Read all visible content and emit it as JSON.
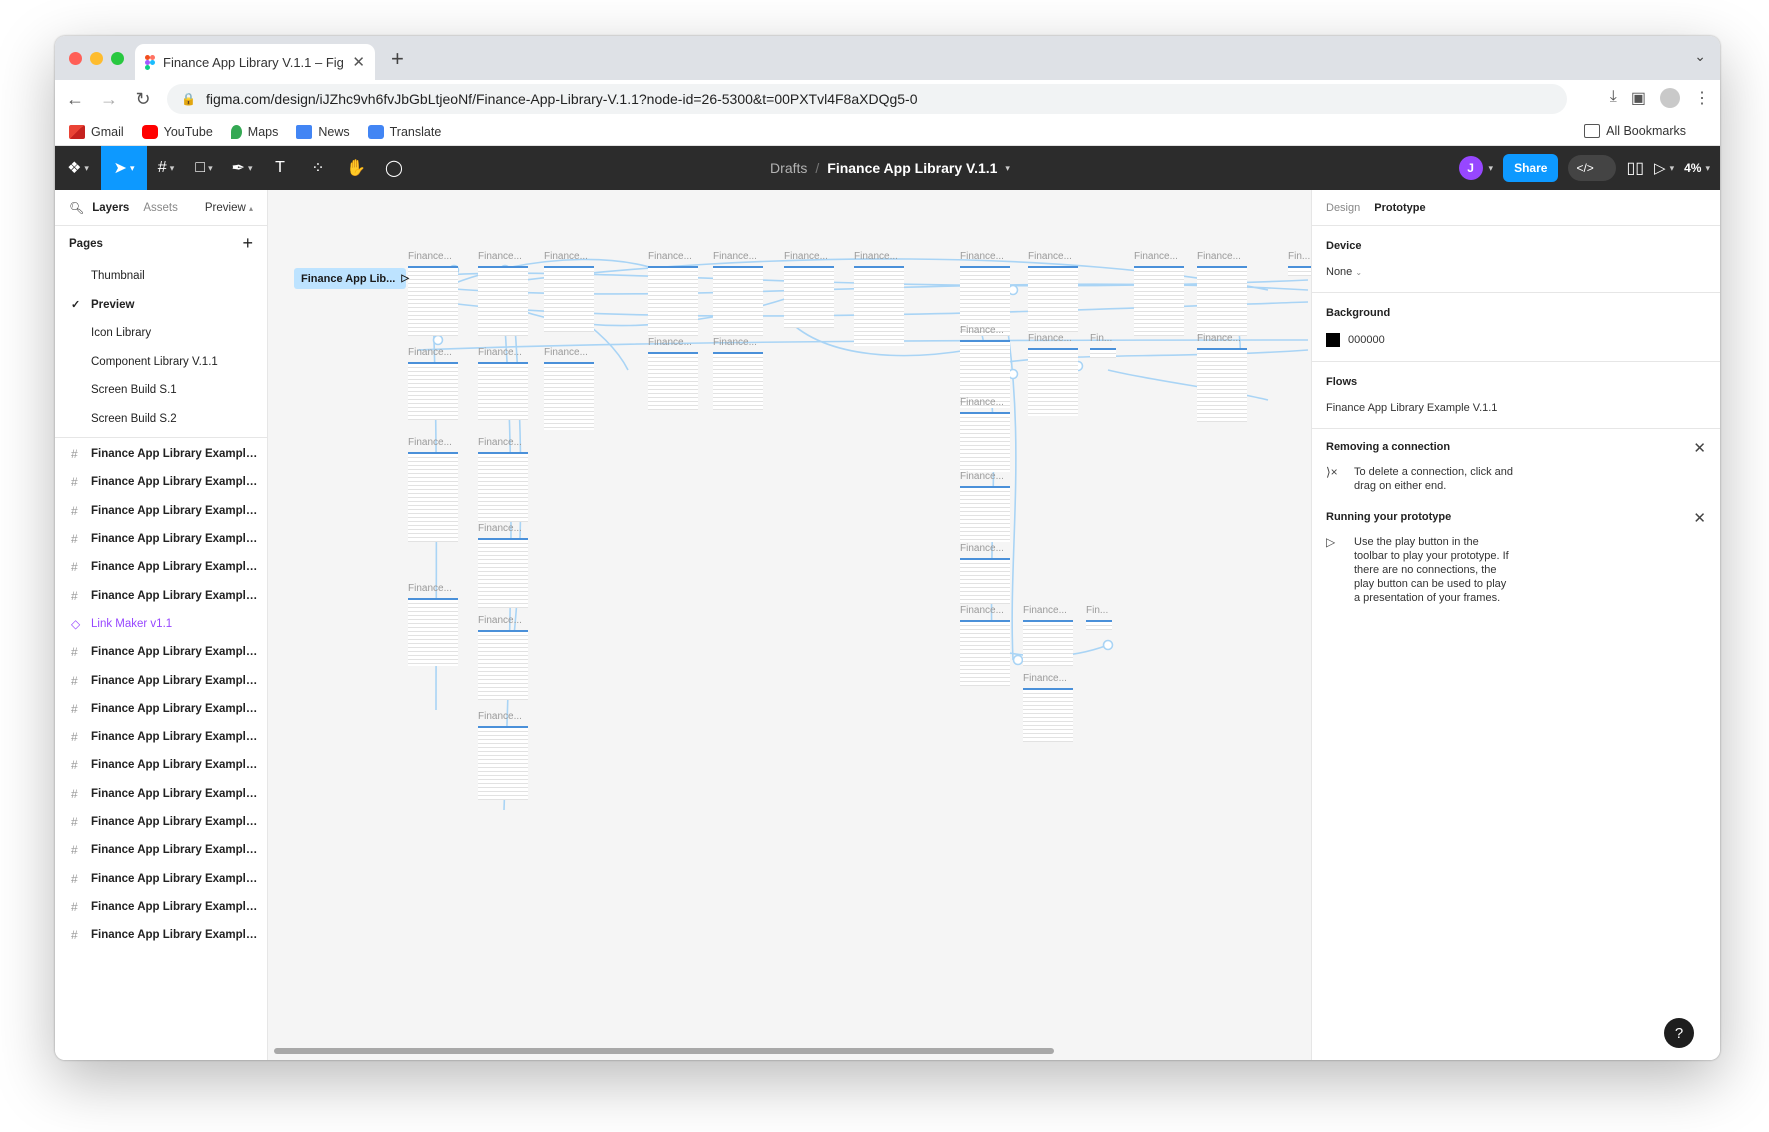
{
  "browser": {
    "tab_title": "Finance App Library V.1.1 – Fig",
    "url": "figma.com/design/iJZhc9vh6fvJbGbLtjeoNf/Finance-App-Library-V.1.1?node-id=26-5300&t=00PXTvl4F8aXDQg5-0",
    "bookmarks": [
      "Gmail",
      "YouTube",
      "Maps",
      "News",
      "Translate"
    ],
    "all_bookmarks": "All Bookmarks"
  },
  "toolbar": {
    "breadcrumb_drafts": "Drafts",
    "file_name": "Finance App Library V.1.1",
    "user_initial": "J",
    "share_label": "Share",
    "zoom": "4%"
  },
  "left_panel": {
    "tab_layers": "Layers",
    "tab_assets": "Assets",
    "page_selector": "Preview",
    "pages_title": "Pages",
    "pages": [
      {
        "label": "Thumbnail",
        "selected": false
      },
      {
        "label": "Preview",
        "selected": true
      },
      {
        "label": "Icon Library",
        "selected": false
      },
      {
        "label": "Component Library V.1.1",
        "selected": false
      },
      {
        "label": "Screen Build S.1",
        "selected": false
      },
      {
        "label": "Screen Build S.2",
        "selected": false
      }
    ],
    "layers": [
      {
        "label": "Finance App Library Example V.1.1...",
        "type": "frame"
      },
      {
        "label": "Finance App Library Example V.1.1...",
        "type": "frame"
      },
      {
        "label": "Finance App Library Example V.1.1...",
        "type": "frame"
      },
      {
        "label": "Finance App Library Example V.1.1...",
        "type": "frame"
      },
      {
        "label": "Finance App Library Example V.1.1...",
        "type": "frame"
      },
      {
        "label": "Finance App Library Example V.1.1...",
        "type": "frame"
      },
      {
        "label": "Link Maker v1.1",
        "type": "component"
      },
      {
        "label": "Finance App Library Example V.1.1...",
        "type": "frame"
      },
      {
        "label": "Finance App Library Example V.1.1...",
        "type": "frame"
      },
      {
        "label": "Finance App Library Example V.1.1...",
        "type": "frame"
      },
      {
        "label": "Finance App Library Example V.1.1...",
        "type": "frame"
      },
      {
        "label": "Finance App Library Example V.1.1...",
        "type": "frame"
      },
      {
        "label": "Finance App Library Example V.1.1...",
        "type": "frame"
      },
      {
        "label": "Finance App Library Example V.1.1...",
        "type": "frame"
      },
      {
        "label": "Finance App Library Example V.1.1...",
        "type": "frame"
      },
      {
        "label": "Finance App Library Example V.1.1...",
        "type": "frame"
      },
      {
        "label": "Finance App Library Example V.1.1...",
        "type": "frame"
      },
      {
        "label": "Finance App Library Example V.1.1...",
        "type": "frame"
      }
    ]
  },
  "canvas": {
    "flow_start_label": "Finance App Lib...",
    "frame_label": "Finance...",
    "frame_label_short": "Fin...",
    "connection_color": "#a9d4f5"
  },
  "right_panel": {
    "tab_design": "Design",
    "tab_prototype": "Prototype",
    "device_title": "Device",
    "device_value": "None",
    "background_title": "Background",
    "background_value": "000000",
    "flows_title": "Flows",
    "flow_name": "Finance App Library Example V.1.1",
    "tip1_title": "Removing a connection",
    "tip1_text": "To delete a connection, click and drag on either end.",
    "tip2_title": "Running your prototype",
    "tip2_text": "Use the play button in the toolbar to play your prototype. If there are no connections, the play button can be used to play a presentation of your frames.",
    "help": "?"
  }
}
